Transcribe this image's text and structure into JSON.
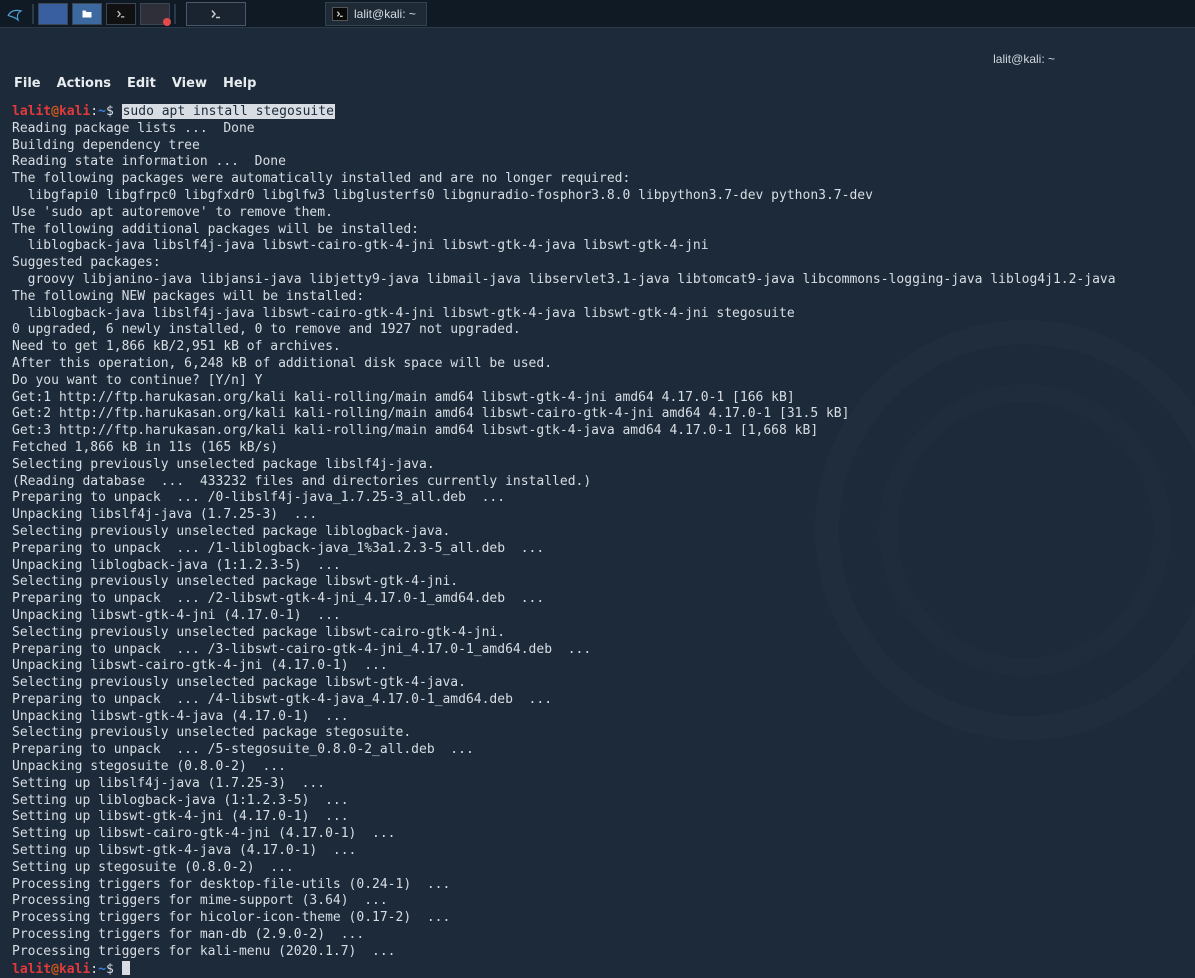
{
  "panel": {
    "window_button_label": "lalit@kali: ~"
  },
  "window": {
    "title": "lalit@kali: ~"
  },
  "menu": {
    "file": "File",
    "actions": "Actions",
    "edit": "Edit",
    "view": "View",
    "help": "Help"
  },
  "prompt": {
    "user": "lalit",
    "at": "@",
    "host": "kali",
    "sep": ":",
    "path": "~",
    "dollar": "$"
  },
  "command": "sudo apt install stegosuite",
  "output_lines": [
    "Reading package lists ...  Done",
    "Building dependency tree",
    "Reading state information ...  Done",
    "The following packages were automatically installed and are no longer required:",
    "  libgfapi0 libgfrpc0 libgfxdr0 libglfw3 libglusterfs0 libgnuradio-fosphor3.8.0 libpython3.7-dev python3.7-dev",
    "Use 'sudo apt autoremove' to remove them.",
    "The following additional packages will be installed:",
    "  liblogback-java libslf4j-java libswt-cairo-gtk-4-jni libswt-gtk-4-java libswt-gtk-4-jni",
    "Suggested packages:",
    "  groovy libjanino-java libjansi-java libjetty9-java libmail-java libservlet3.1-java libtomcat9-java libcommons-logging-java liblog4j1.2-java",
    "The following NEW packages will be installed:",
    "  liblogback-java libslf4j-java libswt-cairo-gtk-4-jni libswt-gtk-4-java libswt-gtk-4-jni stegosuite",
    "0 upgraded, 6 newly installed, 0 to remove and 1927 not upgraded.",
    "Need to get 1,866 kB/2,951 kB of archives.",
    "After this operation, 6,248 kB of additional disk space will be used.",
    "Do you want to continue? [Y/n] Y",
    "Get:1 http://ftp.harukasan.org/kali kali-rolling/main amd64 libswt-gtk-4-jni amd64 4.17.0-1 [166 kB]",
    "Get:2 http://ftp.harukasan.org/kali kali-rolling/main amd64 libswt-cairo-gtk-4-jni amd64 4.17.0-1 [31.5 kB]",
    "Get:3 http://ftp.harukasan.org/kali kali-rolling/main amd64 libswt-gtk-4-java amd64 4.17.0-1 [1,668 kB]",
    "Fetched 1,866 kB in 11s (165 kB/s)",
    "Selecting previously unselected package libslf4j-java.",
    "(Reading database  ...  433232 files and directories currently installed.)",
    "Preparing to unpack  ... /0-libslf4j-java_1.7.25-3_all.deb  ...",
    "Unpacking libslf4j-java (1.7.25-3)  ...",
    "Selecting previously unselected package liblogback-java.",
    "Preparing to unpack  ... /1-liblogback-java_1%3a1.2.3-5_all.deb  ...",
    "Unpacking liblogback-java (1:1.2.3-5)  ...",
    "Selecting previously unselected package libswt-gtk-4-jni.",
    "Preparing to unpack  ... /2-libswt-gtk-4-jni_4.17.0-1_amd64.deb  ...",
    "Unpacking libswt-gtk-4-jni (4.17.0-1)  ...",
    "Selecting previously unselected package libswt-cairo-gtk-4-jni.",
    "Preparing to unpack  ... /3-libswt-cairo-gtk-4-jni_4.17.0-1_amd64.deb  ...",
    "Unpacking libswt-cairo-gtk-4-jni (4.17.0-1)  ...",
    "Selecting previously unselected package libswt-gtk-4-java.",
    "Preparing to unpack  ... /4-libswt-gtk-4-java_4.17.0-1_amd64.deb  ...",
    "Unpacking libswt-gtk-4-java (4.17.0-1)  ...",
    "Selecting previously unselected package stegosuite.",
    "Preparing to unpack  ... /5-stegosuite_0.8.0-2_all.deb  ...",
    "Unpacking stegosuite (0.8.0-2)  ...",
    "Setting up libslf4j-java (1.7.25-3)  ...",
    "Setting up liblogback-java (1:1.2.3-5)  ...",
    "Setting up libswt-gtk-4-jni (4.17.0-1)  ...",
    "Setting up libswt-cairo-gtk-4-jni (4.17.0-1)  ...",
    "Setting up libswt-gtk-4-java (4.17.0-1)  ...",
    "Setting up stegosuite (0.8.0-2)  ...",
    "Processing triggers for desktop-file-utils (0.24-1)  ...",
    "Processing triggers for mime-support (3.64)  ...",
    "Processing triggers for hicolor-icon-theme (0.17-2)  ...",
    "Processing triggers for man-db (2.9.0-2)  ...",
    "Processing triggers for kali-menu (2020.1.7)  ..."
  ]
}
